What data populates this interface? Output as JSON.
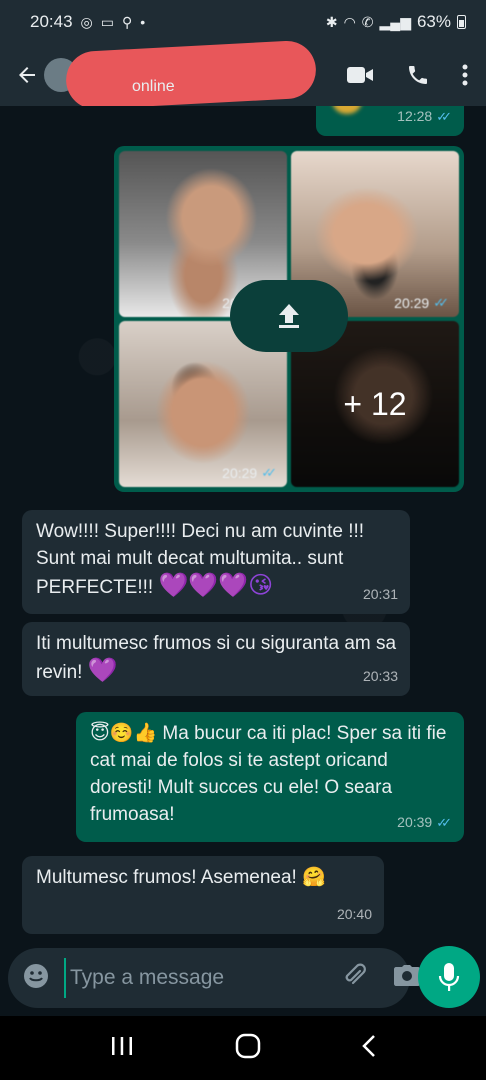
{
  "status_bar": {
    "time": "20:43",
    "battery": "63%"
  },
  "header": {
    "status": "online"
  },
  "top_message": {
    "time": "12:28"
  },
  "album": {
    "tiles": [
      {
        "time": "20:29"
      },
      {
        "time": "20:29"
      },
      {
        "time": "20:29"
      }
    ],
    "more_count": "+ 12"
  },
  "messages": [
    {
      "direction": "in",
      "text": "Wow!!!! Super!!!! Deci nu am cuvinte !!! Sunt mai mult decat multumita.. sunt PERFECTE!!!",
      "emoji": "💜💜💜😘",
      "time": "20:31"
    },
    {
      "direction": "in",
      "text": "Iti multumesc frumos si cu siguranta am sa revin!",
      "emoji": "💜",
      "time": "20:33"
    },
    {
      "direction": "out",
      "emoji": "😇☺️👍",
      "text": "Ma bucur ca iti plac! Sper sa iti fie cat mai de folos si te astept oricand doresti! Mult succes cu ele! O seara frumoasa!",
      "time": "20:39"
    },
    {
      "direction": "in",
      "text": "Multumesc frumos! Asemenea!",
      "emoji": "🤗",
      "time": "20:40"
    }
  ],
  "input": {
    "placeholder": "Type a message"
  },
  "colors": {
    "accent": "#00a884",
    "outgoing": "#005c4b",
    "incoming": "#1f2c34",
    "read_ticks": "#53bdeb"
  }
}
